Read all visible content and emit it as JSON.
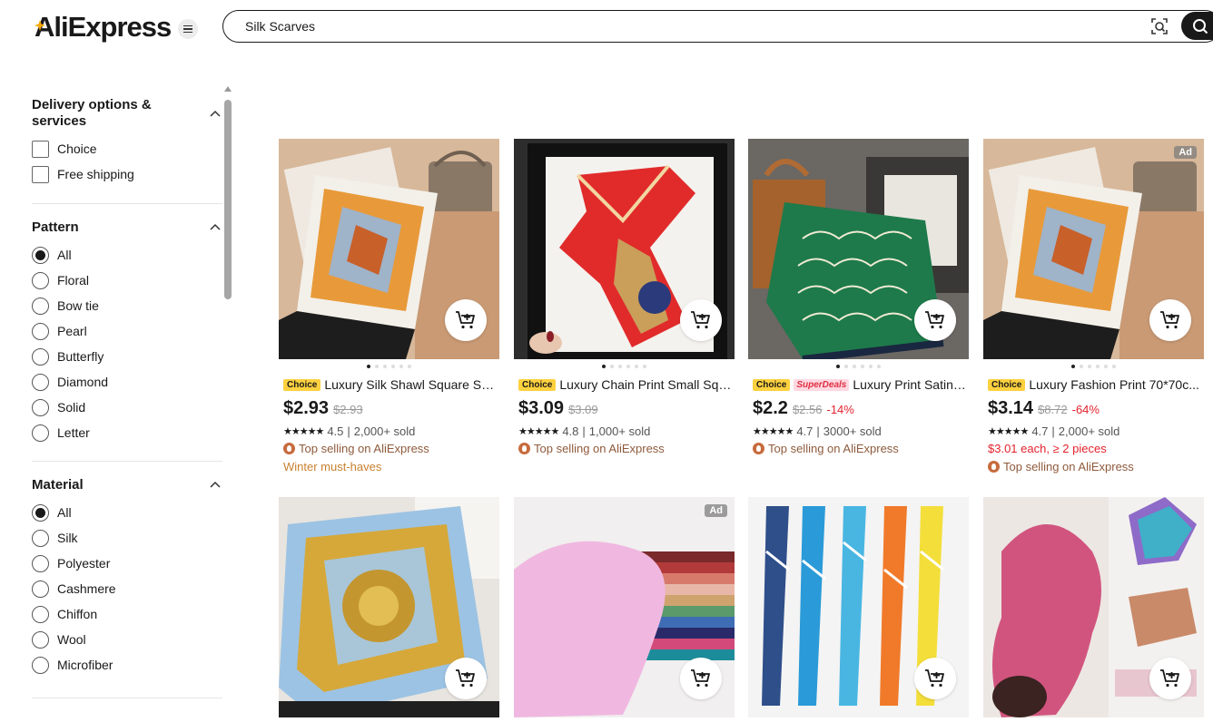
{
  "header": {
    "logo_text": "AliExpress",
    "search_value": "Silk Scarves"
  },
  "sidebar": {
    "delivery": {
      "title": "Delivery options & services",
      "options": [
        "Choice",
        "Free shipping"
      ]
    },
    "pattern": {
      "title": "Pattern",
      "options": [
        "All",
        "Floral",
        "Bow tie",
        "Pearl",
        "Butterfly",
        "Diamond",
        "Solid",
        "Letter"
      ],
      "selected": "All"
    },
    "material": {
      "title": "Material",
      "options": [
        "All",
        "Silk",
        "Polyester",
        "Cashmere",
        "Chiffon",
        "Wool",
        "Microfiber"
      ],
      "selected": "All"
    }
  },
  "products": [
    {
      "title": "Luxury Silk Shawl Square Sca...",
      "choice": "Choice",
      "price": "$2.93",
      "orig": "$2.93",
      "rating": "4.5",
      "sold": "2,000+ sold",
      "top": "Top selling on AliExpress",
      "promo": "Winter must-haves"
    },
    {
      "title": "Luxury Chain Print Small Squ...",
      "choice": "Choice",
      "price": "$3.09",
      "orig": "$3.09",
      "rating": "4.8",
      "sold": "1,000+ sold",
      "top": "Top selling on AliExpress"
    },
    {
      "title": "Luxury Print Satin S...",
      "choice": "Choice",
      "superdeals": "SuperDeals",
      "price": "$2.2",
      "orig": "$2.56",
      "disc": "-14%",
      "rating": "4.7",
      "sold": "3000+ sold",
      "top": "Top selling on AliExpress"
    },
    {
      "title": "Luxury Fashion Print 70*70c...",
      "choice": "Choice",
      "price": "$3.14",
      "orig": "$8.72",
      "disc": "-64%",
      "rating": "4.7",
      "sold": "2,000+ sold",
      "each": "$3.01 each, ≥ 2 pieces",
      "top": "Top selling on AliExpress",
      "ad": "Ad"
    },
    {
      "ad": ""
    },
    {
      "ad": "Ad"
    },
    {
      "ad": ""
    },
    {
      "ad": ""
    }
  ],
  "labels": {
    "sold_sep": "|"
  }
}
